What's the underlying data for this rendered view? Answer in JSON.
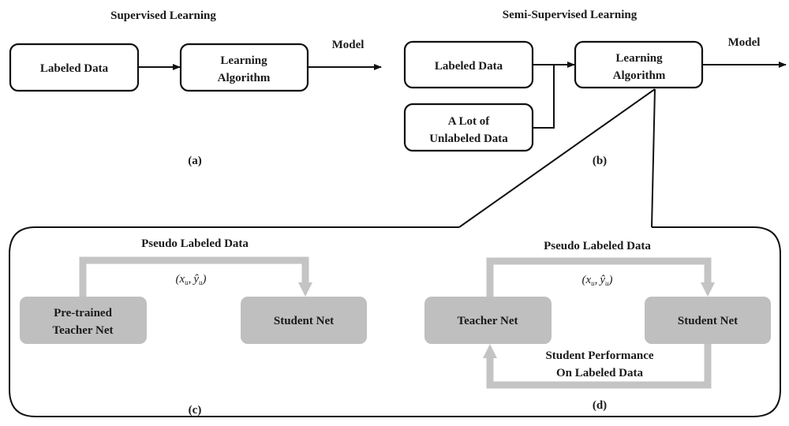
{
  "colors": {
    "outline": "#111111",
    "gray_box": "#bfbfbf",
    "gray_connector": "#c4c4c4",
    "text": "#1a1a1a",
    "background": "#ffffff"
  },
  "panel_a": {
    "title": "Supervised Learning",
    "boxes": [
      "Labeled Data",
      "Learning Algorithm"
    ],
    "box_lines": {
      "labeled": [
        "Labeled Data"
      ],
      "algo": [
        "Learning",
        "Algorithm"
      ]
    },
    "output_label": "Model",
    "caption": "(a)"
  },
  "panel_b": {
    "title": "Semi-Supervised Learning",
    "box_lines": {
      "labeled": [
        "Labeled Data"
      ],
      "unlabeled": [
        "A Lot of",
        "Unlabeled Data"
      ],
      "algo": [
        "Learning",
        "Algorithm"
      ]
    },
    "output_label": "Model",
    "caption": "(b)"
  },
  "panel_c": {
    "flow_label": "Pseudo Labeled Data",
    "math_label": {
      "open": "(",
      "x": "x",
      "x_sub": "u",
      "comma": ",",
      "y": "ŷ",
      "y_sub": "u",
      "close": ")"
    },
    "teacher_lines": [
      "Pre-trained",
      "Teacher Net"
    ],
    "student_lines": [
      "Student Net"
    ],
    "caption": "(c)"
  },
  "panel_d": {
    "flow_label": "Pseudo Labeled Data",
    "math_label": {
      "open": "(",
      "x": "x",
      "x_sub": "u",
      "comma": ",",
      "y": "ŷ",
      "y_sub": "u",
      "close": ")"
    },
    "teacher_lines": [
      "Teacher Net"
    ],
    "student_lines": [
      "Student Net"
    ],
    "feedback_lines": [
      "Student Performance",
      "On Labeled Data"
    ],
    "caption": "(d)"
  }
}
